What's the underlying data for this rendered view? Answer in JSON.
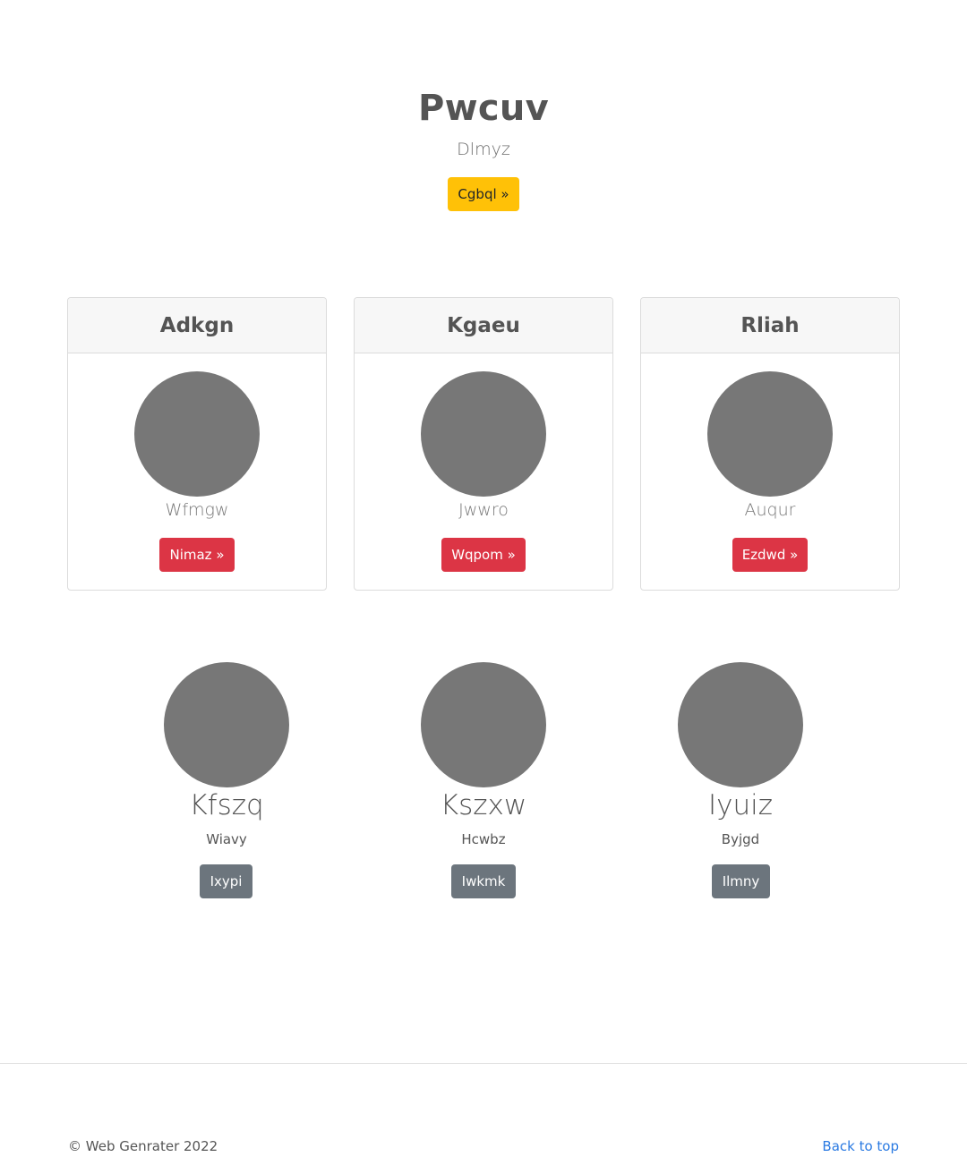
{
  "hero": {
    "title": "Pwcuv",
    "subtitle": "Dlmyz",
    "button_label": "Cgbql »",
    "button_color": "#ffc107"
  },
  "cards": [
    {
      "header": "Adkgn",
      "text": "Wfmgw",
      "button_label": "Nimaz »"
    },
    {
      "header": "Kgaeu",
      "text": "Jwwro",
      "button_label": "Wqpom »"
    },
    {
      "header": "Rliah",
      "text": "Auqur",
      "button_label": "Ezdwd »"
    }
  ],
  "card_button_color": "#dc3545",
  "people": [
    {
      "name": "Kfszq",
      "role": "Wiavy",
      "button_label": "Ixypi"
    },
    {
      "name": "Kszxw",
      "role": "Hcwbz",
      "button_label": "Iwkmk"
    },
    {
      "name": "Iyuiz",
      "role": "Byjgd",
      "button_label": "Ilmny"
    }
  ],
  "person_button_color": "#6c757d",
  "footer": {
    "copyright": "© Web Genrater 2022",
    "back_to_top": "Back to top",
    "link_color": "#2a7ae2"
  }
}
